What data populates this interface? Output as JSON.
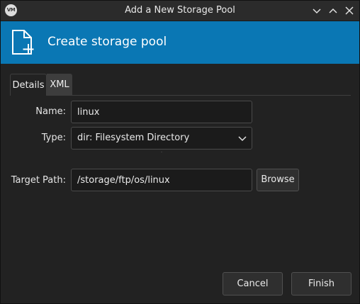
{
  "window": {
    "title": "Add a New Storage Pool",
    "app_icon_text": "VM"
  },
  "header": {
    "title": "Create storage pool",
    "icon": "new-document-icon",
    "background": "#0a77b4"
  },
  "tabs": [
    {
      "label": "Details",
      "active": true
    },
    {
      "label": "XML",
      "active": false
    }
  ],
  "form": {
    "name_label": "Name:",
    "name_value": "linux",
    "type_label": "Type:",
    "type_value": "dir: Filesystem Directory",
    "target_label": "Target Path:",
    "target_value": "/storage/ftp/os/linux",
    "browse_label": "Browse"
  },
  "footer": {
    "cancel_label": "Cancel",
    "finish_label": "Finish"
  }
}
